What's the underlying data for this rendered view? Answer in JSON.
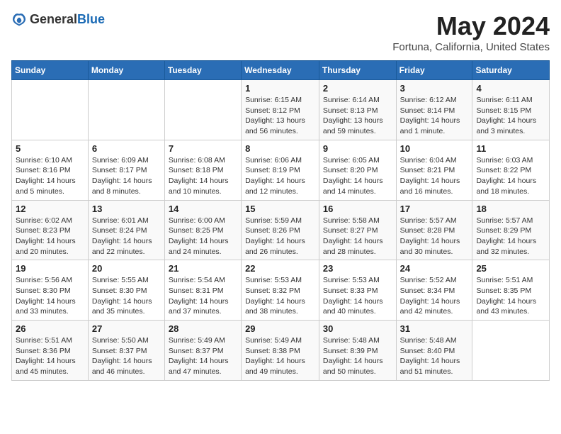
{
  "header": {
    "logo_general": "General",
    "logo_blue": "Blue",
    "month": "May 2024",
    "location": "Fortuna, California, United States"
  },
  "days_of_week": [
    "Sunday",
    "Monday",
    "Tuesday",
    "Wednesday",
    "Thursday",
    "Friday",
    "Saturday"
  ],
  "weeks": [
    [
      {
        "num": "",
        "info": ""
      },
      {
        "num": "",
        "info": ""
      },
      {
        "num": "",
        "info": ""
      },
      {
        "num": "1",
        "info": "Sunrise: 6:15 AM\nSunset: 8:12 PM\nDaylight: 13 hours and 56 minutes."
      },
      {
        "num": "2",
        "info": "Sunrise: 6:14 AM\nSunset: 8:13 PM\nDaylight: 13 hours and 59 minutes."
      },
      {
        "num": "3",
        "info": "Sunrise: 6:12 AM\nSunset: 8:14 PM\nDaylight: 14 hours and 1 minute."
      },
      {
        "num": "4",
        "info": "Sunrise: 6:11 AM\nSunset: 8:15 PM\nDaylight: 14 hours and 3 minutes."
      }
    ],
    [
      {
        "num": "5",
        "info": "Sunrise: 6:10 AM\nSunset: 8:16 PM\nDaylight: 14 hours and 5 minutes."
      },
      {
        "num": "6",
        "info": "Sunrise: 6:09 AM\nSunset: 8:17 PM\nDaylight: 14 hours and 8 minutes."
      },
      {
        "num": "7",
        "info": "Sunrise: 6:08 AM\nSunset: 8:18 PM\nDaylight: 14 hours and 10 minutes."
      },
      {
        "num": "8",
        "info": "Sunrise: 6:06 AM\nSunset: 8:19 PM\nDaylight: 14 hours and 12 minutes."
      },
      {
        "num": "9",
        "info": "Sunrise: 6:05 AM\nSunset: 8:20 PM\nDaylight: 14 hours and 14 minutes."
      },
      {
        "num": "10",
        "info": "Sunrise: 6:04 AM\nSunset: 8:21 PM\nDaylight: 14 hours and 16 minutes."
      },
      {
        "num": "11",
        "info": "Sunrise: 6:03 AM\nSunset: 8:22 PM\nDaylight: 14 hours and 18 minutes."
      }
    ],
    [
      {
        "num": "12",
        "info": "Sunrise: 6:02 AM\nSunset: 8:23 PM\nDaylight: 14 hours and 20 minutes."
      },
      {
        "num": "13",
        "info": "Sunrise: 6:01 AM\nSunset: 8:24 PM\nDaylight: 14 hours and 22 minutes."
      },
      {
        "num": "14",
        "info": "Sunrise: 6:00 AM\nSunset: 8:25 PM\nDaylight: 14 hours and 24 minutes."
      },
      {
        "num": "15",
        "info": "Sunrise: 5:59 AM\nSunset: 8:26 PM\nDaylight: 14 hours and 26 minutes."
      },
      {
        "num": "16",
        "info": "Sunrise: 5:58 AM\nSunset: 8:27 PM\nDaylight: 14 hours and 28 minutes."
      },
      {
        "num": "17",
        "info": "Sunrise: 5:57 AM\nSunset: 8:28 PM\nDaylight: 14 hours and 30 minutes."
      },
      {
        "num": "18",
        "info": "Sunrise: 5:57 AM\nSunset: 8:29 PM\nDaylight: 14 hours and 32 minutes."
      }
    ],
    [
      {
        "num": "19",
        "info": "Sunrise: 5:56 AM\nSunset: 8:30 PM\nDaylight: 14 hours and 33 minutes."
      },
      {
        "num": "20",
        "info": "Sunrise: 5:55 AM\nSunset: 8:30 PM\nDaylight: 14 hours and 35 minutes."
      },
      {
        "num": "21",
        "info": "Sunrise: 5:54 AM\nSunset: 8:31 PM\nDaylight: 14 hours and 37 minutes."
      },
      {
        "num": "22",
        "info": "Sunrise: 5:53 AM\nSunset: 8:32 PM\nDaylight: 14 hours and 38 minutes."
      },
      {
        "num": "23",
        "info": "Sunrise: 5:53 AM\nSunset: 8:33 PM\nDaylight: 14 hours and 40 minutes."
      },
      {
        "num": "24",
        "info": "Sunrise: 5:52 AM\nSunset: 8:34 PM\nDaylight: 14 hours and 42 minutes."
      },
      {
        "num": "25",
        "info": "Sunrise: 5:51 AM\nSunset: 8:35 PM\nDaylight: 14 hours and 43 minutes."
      }
    ],
    [
      {
        "num": "26",
        "info": "Sunrise: 5:51 AM\nSunset: 8:36 PM\nDaylight: 14 hours and 45 minutes."
      },
      {
        "num": "27",
        "info": "Sunrise: 5:50 AM\nSunset: 8:37 PM\nDaylight: 14 hours and 46 minutes."
      },
      {
        "num": "28",
        "info": "Sunrise: 5:49 AM\nSunset: 8:37 PM\nDaylight: 14 hours and 47 minutes."
      },
      {
        "num": "29",
        "info": "Sunrise: 5:49 AM\nSunset: 8:38 PM\nDaylight: 14 hours and 49 minutes."
      },
      {
        "num": "30",
        "info": "Sunrise: 5:48 AM\nSunset: 8:39 PM\nDaylight: 14 hours and 50 minutes."
      },
      {
        "num": "31",
        "info": "Sunrise: 5:48 AM\nSunset: 8:40 PM\nDaylight: 14 hours and 51 minutes."
      },
      {
        "num": "",
        "info": ""
      }
    ]
  ]
}
